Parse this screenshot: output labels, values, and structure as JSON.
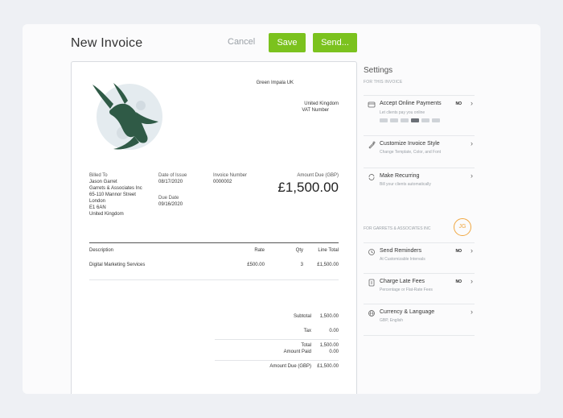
{
  "header": {
    "title": "New Invoice",
    "cancel_label": "Cancel",
    "save_label": "Save",
    "send_label": "Send..."
  },
  "invoice": {
    "company_name": "Green Impala UK",
    "company_country": "United Kingdom",
    "vat_label": "VAT Number",
    "billed_to_label": "Billed To",
    "billed_to_lines": [
      "Jason Garret",
      "Garrets & Associates Inc",
      "65-110 Mannor Street",
      "London",
      "E1 6AN",
      "United Kingdom"
    ],
    "date_issue_label": "Date of Issue",
    "date_issue": "08/17/2020",
    "due_date_label": "Due Date",
    "due_date": "09/16/2020",
    "invoice_number_label": "Invoice Number",
    "invoice_number": "0000002",
    "amount_due_label": "Amount Due (GBP)",
    "amount_due": "£1,500.00",
    "columns": {
      "description": "Description",
      "rate": "Rate",
      "qty": "Qty",
      "line_total": "Line Total"
    },
    "line": {
      "description": "Digital Marketing Services",
      "rate": "£500.00",
      "qty": "3",
      "line_total": "£1,500.00"
    },
    "totals": {
      "subtotal_label": "Subtotal",
      "subtotal": "1,500.00",
      "tax_label": "Tax",
      "tax": "0.00",
      "total_label": "Total",
      "total": "1,500.00",
      "paid_label": "Amount Paid",
      "paid": "0.00",
      "due_label": "Amount Due (GBP)",
      "due": "£1,500.00"
    }
  },
  "settings": {
    "title": "Settings",
    "section1": "FOR THIS INVOICE",
    "online": {
      "title": "Accept Online Payments",
      "sub": "Let clients pay you online",
      "status": "NO"
    },
    "style": {
      "title": "Customize Invoice Style",
      "sub": "Change Template, Color, and Font"
    },
    "recurring": {
      "title": "Make Recurring",
      "sub": "Bill your clients automatically"
    },
    "section2": "FOR GARRETS & ASSOCIATES INC",
    "client_initials": "JG",
    "reminders": {
      "title": "Send Reminders",
      "sub": "At Customizable Intervals",
      "status": "NO"
    },
    "late_fees": {
      "title": "Charge Late Fees",
      "sub": "Percentage or Flat-Rate Fees",
      "status": "NO"
    },
    "currency": {
      "title": "Currency & Language",
      "sub": "GBP, English"
    }
  },
  "colors": {
    "accent_green": "#7bc21e",
    "logo_green": "#2f5a46",
    "initials_orange": "#f0a741"
  }
}
